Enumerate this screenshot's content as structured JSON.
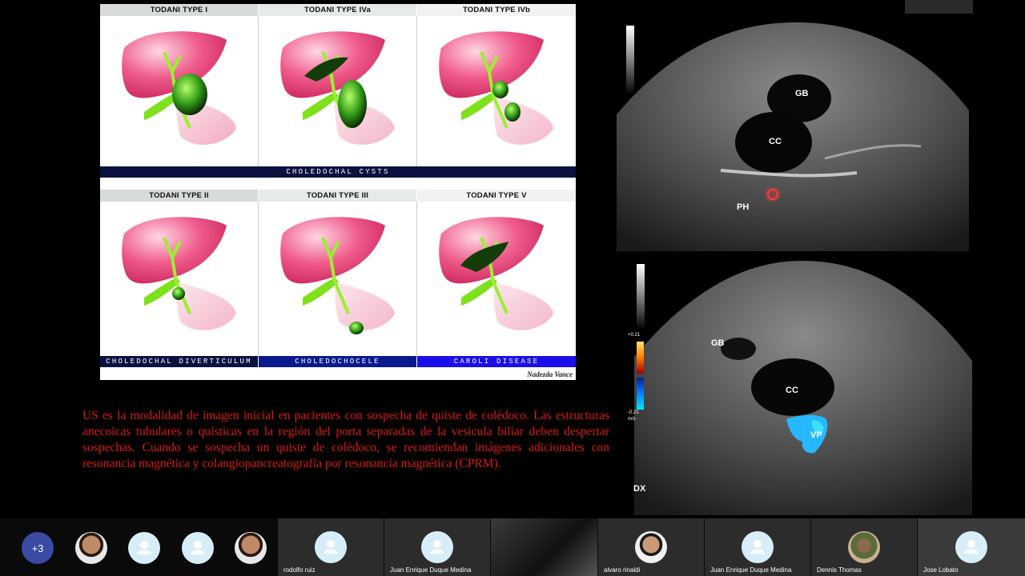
{
  "figure": {
    "top_row": [
      {
        "label": "TODANI TYPE I"
      },
      {
        "label": "TODANI TYPE IVa"
      },
      {
        "label": "TODANI TYPE IVb"
      }
    ],
    "top_band": "CHOLEDOCHAL CYSTS",
    "bottom_row": [
      {
        "label": "TODANI TYPE II",
        "band": "CHOLEDOCHAL DIVERTICULUM"
      },
      {
        "label": "TODANI TYPE III",
        "band": "CHOLEDOCHOCELE"
      },
      {
        "label": "TODANI TYPE V",
        "band": "CAROLI DISEASE"
      }
    ],
    "signature": "Nadezda Vance",
    "colors": {
      "liver": "#e8457a",
      "duct": "#7fe01c",
      "band_dark": "#0a1240",
      "band_blue": "#1a0fe8"
    }
  },
  "caption": "US es la modalidad de imagen inicial en pacientes con sospecha de quiste de colédoco. Las estructuras anecoicas tubulares o quísticas en la región del porta separadas de la vesicula biliar deben despertar sospechas. Cuando se sospecha un quiste de colédoco, se recomiendan imágenes adicionales con resonancia magnética y colangiopancreatografía por resonancia magnética (CPRM).",
  "ultrasound_top": {
    "labels": {
      "gb": "GB",
      "cc": "CC",
      "ph": "PH"
    }
  },
  "ultrasound_bottom": {
    "labels": {
      "gb": "GB",
      "cc": "CC",
      "vp": "VP",
      "dx": "DX"
    },
    "scale": {
      "max": "+0.21",
      "min": "-0.21",
      "unit": "m/s"
    }
  },
  "participants": {
    "more_count": "+3",
    "tiles": [
      {
        "name": "rodolfo ruiz"
      },
      {
        "name": "Juan Enrique Duque Medina"
      },
      {
        "name": ""
      },
      {
        "name": "alvaro rinaldi"
      },
      {
        "name": "Juan Enrique Duque Medina"
      },
      {
        "name": "Dennis Thomas"
      },
      {
        "name": "Jose Lobato"
      }
    ]
  }
}
